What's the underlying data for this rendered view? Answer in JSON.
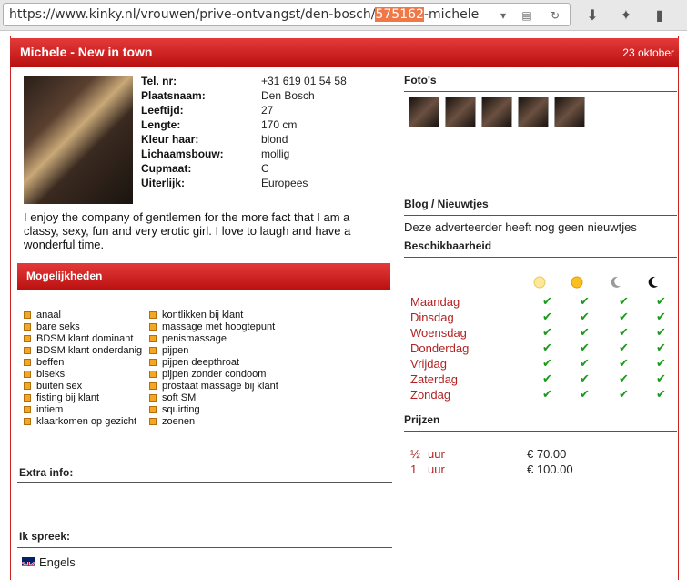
{
  "browser": {
    "url_prefix": "https://www.kinky.nl/vrouwen/prive-ontvangst/den-bosch/",
    "url_selected": "575162",
    "url_suffix": "-michele"
  },
  "header": {
    "title": "Michele - New in town",
    "date": "23 oktober"
  },
  "profile": [
    {
      "key": "Tel. nr:",
      "value": "+31 619 01 54 58"
    },
    {
      "key": "Plaatsnaam:",
      "value": "Den Bosch"
    },
    {
      "key": "Leeftijd:",
      "value": "27"
    },
    {
      "key": "Lengte:",
      "value": "170 cm"
    },
    {
      "key": "Kleur haar:",
      "value": "blond"
    },
    {
      "key": "Lichaamsbouw:",
      "value": "mollig"
    },
    {
      "key": "Cupmaat:",
      "value": "C"
    },
    {
      "key": "Uiterlijk:",
      "value": "Europees"
    }
  ],
  "description": "I enjoy the company of gentlemen for the more fact that I am a classy, sexy, fun and very erotic girl. I love to laugh and have a wonderful time.",
  "mogelijkheden": {
    "title": "Mogelijkheden",
    "left": [
      "anaal",
      "bare seks",
      "BDSM klant dominant",
      "BDSM klant onderdanig",
      "beffen",
      "biseks",
      "buiten sex",
      "fisting bij klant",
      "intiem",
      "klaarkomen op gezicht"
    ],
    "right": [
      "kontlikken bij klant",
      "massage met hoogtepunt",
      "penismassage",
      "pijpen",
      "pijpen deepthroat",
      "pijpen zonder condoom",
      "prostaat massage bij klant",
      "soft SM",
      "squirting",
      "zoenen"
    ]
  },
  "extra_info": {
    "title": "Extra info:"
  },
  "languages": {
    "title": "Ik spreek:",
    "items": [
      "Engels"
    ]
  },
  "fotos": {
    "title": "Foto's",
    "count": 5
  },
  "blog": {
    "title": "Blog / Nieuwtjes",
    "text": "Deze adverteerder heeft nog geen nieuwtjes"
  },
  "availability": {
    "title": "Beschikbaarheid",
    "icons": [
      "morning-sun-icon",
      "afternoon-sun-icon",
      "evening-moon-icon",
      "night-moon-icon"
    ],
    "days": [
      "Maandag",
      "Dinsdag",
      "Woensdag",
      "Donderdag",
      "Vrijdag",
      "Zaterdag",
      "Zondag"
    ],
    "check": "✔"
  },
  "prices": {
    "title": "Prijzen",
    "rows": [
      {
        "amount": "½",
        "unit": "uur",
        "price": "€ 70.00"
      },
      {
        "amount": "1",
        "unit": "uur",
        "price": "€ 100.00"
      }
    ]
  }
}
